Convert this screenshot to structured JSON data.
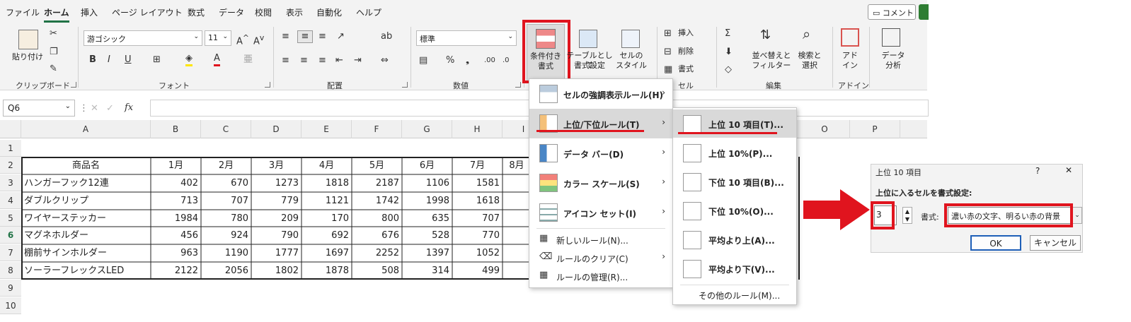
{
  "menu_tabs": [
    "ファイル",
    "ホーム",
    "挿入",
    "ページ レイアウト",
    "数式",
    "データ",
    "校閲",
    "表示",
    "自動化",
    "ヘルプ"
  ],
  "comment_label": "コメント",
  "ribbon": {
    "paste": "貼り付け",
    "clipboard_group": "クリップボード",
    "font_name": "游ゴシック",
    "font_size": "11",
    "font_group": "フォント",
    "align_group": "配置",
    "number_format": "標準",
    "number_group": "数値",
    "cond_format_1": "条件付き",
    "cond_format_2": "書式",
    "table_format_1": "テーブルとして",
    "table_format_2": "書式設定",
    "cell_style_1": "セルの",
    "cell_style_2": "スタイル",
    "insert": "挿入",
    "delete": "削除",
    "format": "書式",
    "cells_group": "セル",
    "sort_1": "並べ替えと",
    "sort_2": "フィルター",
    "find_1": "検索と",
    "find_2": "選択",
    "edit_group": "編集",
    "addin_1": "アド",
    "addin_2": "イン",
    "addin_group": "アドイン",
    "data_1": "データ",
    "data_2": "分析"
  },
  "name_box": "Q6",
  "fx_label": "fx",
  "columns": [
    "A",
    "B",
    "C",
    "D",
    "E",
    "F",
    "G",
    "H",
    "I",
    "O",
    "P"
  ],
  "rows": [
    "1",
    "2",
    "3",
    "4",
    "5",
    "6",
    "7",
    "8",
    "9",
    "10"
  ],
  "table": {
    "header": [
      "商品名",
      "1月",
      "2月",
      "3月",
      "4月",
      "5月",
      "6月",
      "7月",
      "8月"
    ],
    "rows": [
      {
        "name": "ハンガーフック12連",
        "values": [
          "402",
          "670",
          "1273",
          "1818",
          "2187",
          "1106",
          "1581"
        ]
      },
      {
        "name": "ダブルクリップ",
        "values": [
          "713",
          "707",
          "779",
          "1121",
          "1742",
          "1998",
          "1618"
        ]
      },
      {
        "name": "ワイヤーステッカー",
        "values": [
          "1984",
          "780",
          "209",
          "170",
          "800",
          "635",
          "707"
        ]
      },
      {
        "name": "マグネホルダー",
        "values": [
          "456",
          "924",
          "790",
          "692",
          "676",
          "528",
          "770"
        ]
      },
      {
        "name": "棚前サインホルダー",
        "values": [
          "963",
          "1190",
          "1777",
          "1697",
          "2252",
          "1397",
          "1052"
        ]
      },
      {
        "name": "ソーラーフレックスLED",
        "values": [
          "2122",
          "2056",
          "1802",
          "1878",
          "508",
          "314",
          "499"
        ]
      }
    ]
  },
  "cf_menu": [
    {
      "label": "セルの強調表示ルール(H)",
      "icon": "highlight-rules-icon"
    },
    {
      "label": "上位/下位ルール(T)",
      "icon": "top-bottom-rules-icon"
    },
    {
      "label": "データ バー(D)",
      "icon": "data-bars-icon"
    },
    {
      "label": "カラー スケール(S)",
      "icon": "color-scales-icon"
    },
    {
      "label": "アイコン セット(I)",
      "icon": "icon-sets-icon"
    },
    {
      "label": "新しいルール(N)...",
      "icon": "new-rule-icon"
    },
    {
      "label": "ルールのクリア(C)",
      "icon": "clear-rules-icon"
    },
    {
      "label": "ルールの管理(R)...",
      "icon": "manage-rules-icon"
    }
  ],
  "sub_menu": [
    {
      "label": "上位 10 項目(T)...",
      "icon": "top-10-icon"
    },
    {
      "label": "上位 10%(P)...",
      "icon": "top-10-percent-icon"
    },
    {
      "label": "下位 10 項目(B)...",
      "icon": "bottom-10-icon"
    },
    {
      "label": "下位 10%(O)...",
      "icon": "bottom-10-percent-icon"
    },
    {
      "label": "平均より上(A)...",
      "icon": "above-average-icon"
    },
    {
      "label": "平均より下(V)...",
      "icon": "below-average-icon"
    },
    {
      "label": "その他のルール(M)...",
      "icon": ""
    }
  ],
  "dialog": {
    "title": "上位 10 項目",
    "help": "?",
    "close": "✕",
    "heading": "上位に入るセルを書式設定:",
    "count": "3",
    "format_label": "書式:",
    "format_value": "濃い赤の文字、明るい赤の背景",
    "ok": "OK",
    "cancel": "キャンセル"
  },
  "colors": {
    "accent": "#217346",
    "highlight": "#e0141e"
  }
}
